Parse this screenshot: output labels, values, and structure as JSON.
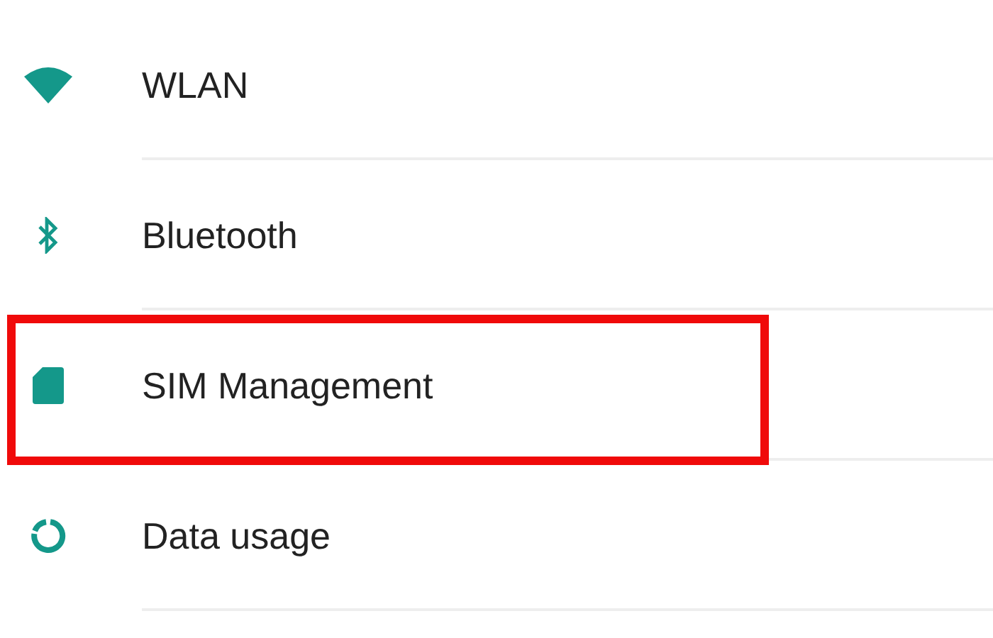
{
  "settings": [
    {
      "kind": "wifi",
      "label": "WLAN",
      "highlighted": false
    },
    {
      "kind": "bluetooth",
      "label": "Bluetooth",
      "highlighted": false
    },
    {
      "kind": "sim",
      "label": "SIM Management",
      "highlighted": true
    },
    {
      "kind": "data",
      "label": "Data usage",
      "highlighted": false
    }
  ]
}
